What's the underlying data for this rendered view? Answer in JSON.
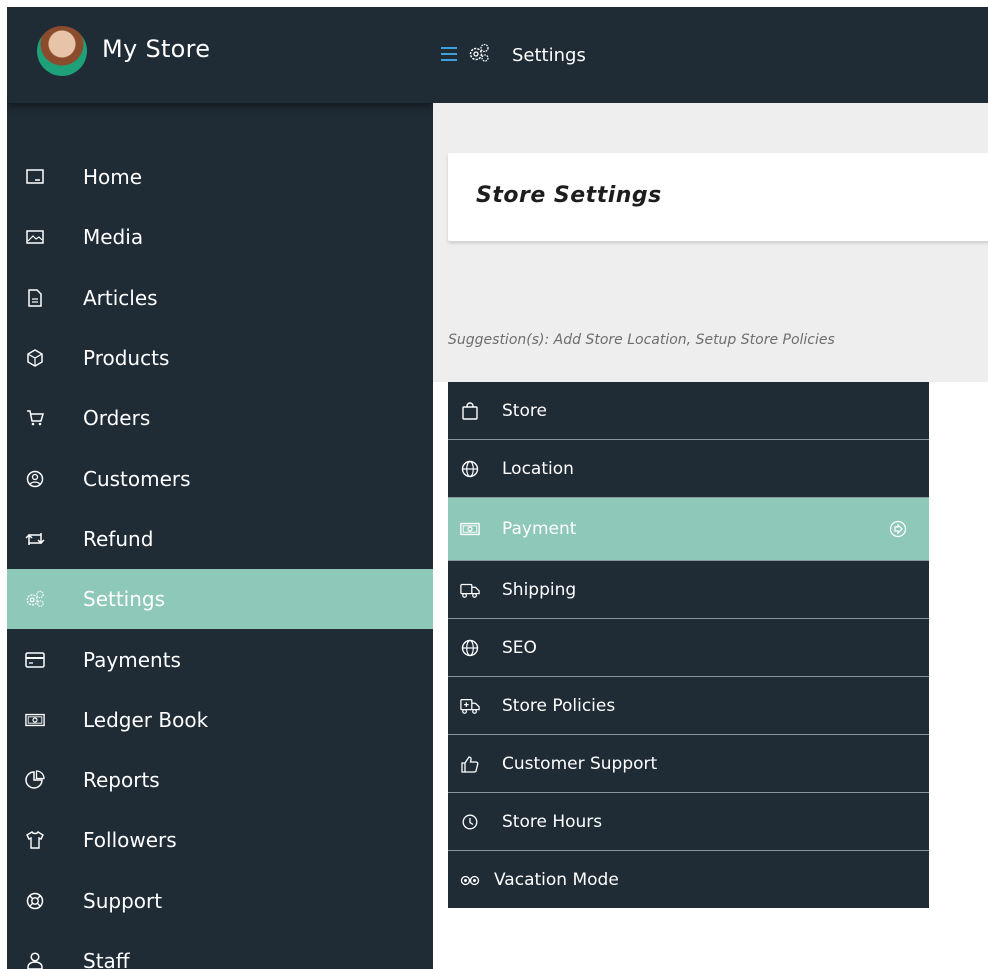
{
  "brand": {
    "name": "My Store"
  },
  "topbar": {
    "title": "Settings"
  },
  "nav": {
    "items": [
      {
        "label": "Home",
        "icon": "home-icon"
      },
      {
        "label": "Media",
        "icon": "image-icon"
      },
      {
        "label": "Articles",
        "icon": "document-icon"
      },
      {
        "label": "Products",
        "icon": "cube-icon"
      },
      {
        "label": "Orders",
        "icon": "cart-icon"
      },
      {
        "label": "Customers",
        "icon": "user-circle-icon"
      },
      {
        "label": "Refund",
        "icon": "refund-icon"
      },
      {
        "label": "Settings",
        "icon": "gears-icon",
        "active": true
      },
      {
        "label": "Payments",
        "icon": "credit-card-icon"
      },
      {
        "label": "Ledger Book",
        "icon": "money-icon"
      },
      {
        "label": "Reports",
        "icon": "pie-chart-icon"
      },
      {
        "label": "Followers",
        "icon": "tshirt-icon"
      },
      {
        "label": "Support",
        "icon": "lifebuoy-icon"
      },
      {
        "label": "Staff",
        "icon": "user-icon"
      }
    ]
  },
  "page": {
    "title": "Store Settings",
    "suggestion": "Suggestion(s): Add Store Location, Setup Store Policies"
  },
  "settings_menu": {
    "items": [
      {
        "label": "Store",
        "icon": "bag-icon"
      },
      {
        "label": "Location",
        "icon": "globe-icon"
      },
      {
        "label": "Payment",
        "icon": "money-icon",
        "active": true
      },
      {
        "label": "Shipping",
        "icon": "truck-icon"
      },
      {
        "label": "SEO",
        "icon": "globe-icon"
      },
      {
        "label": "Store Policies",
        "icon": "ambulance-icon"
      },
      {
        "label": "Customer Support",
        "icon": "thumbs-up-icon"
      },
      {
        "label": "Store Hours",
        "icon": "clock-icon"
      },
      {
        "label": "Vacation Mode",
        "icon": "tripadvisor-icon"
      }
    ]
  },
  "colors": {
    "dark": "#1f2b35",
    "accent": "#8ec8b8",
    "content_bg": "#eeeeef",
    "hamburger": "#3da0d8"
  }
}
